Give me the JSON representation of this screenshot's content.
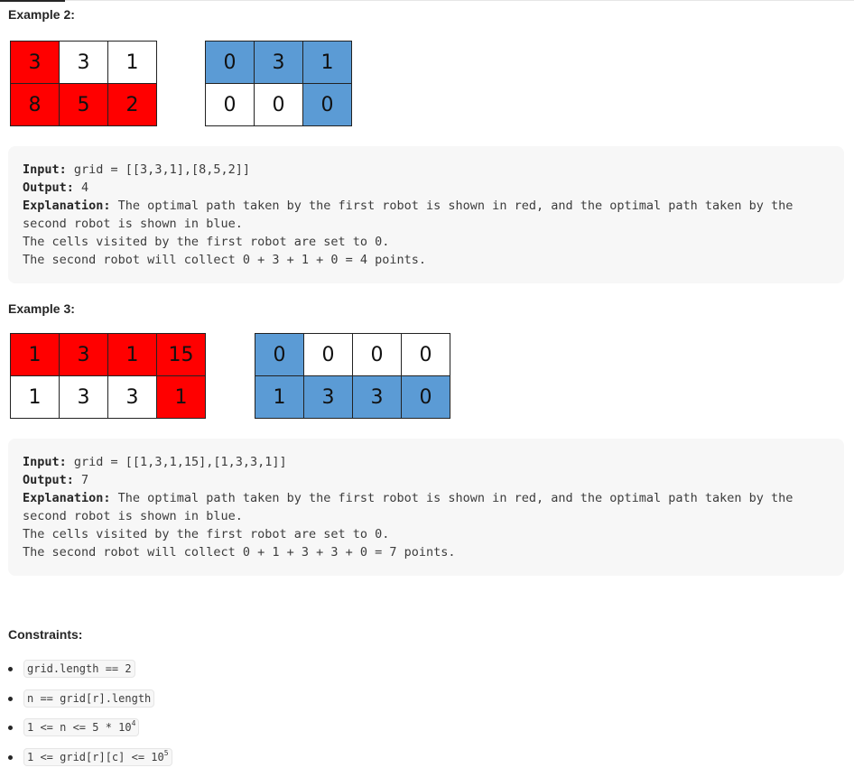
{
  "example2": {
    "heading": "Example 2:",
    "grid_red": [
      [
        {
          "v": "3",
          "c": "red"
        },
        {
          "v": "3",
          "c": "white"
        },
        {
          "v": "1",
          "c": "white"
        }
      ],
      [
        {
          "v": "8",
          "c": "red"
        },
        {
          "v": "5",
          "c": "red"
        },
        {
          "v": "2",
          "c": "red"
        }
      ]
    ],
    "grid_blue": [
      [
        {
          "v": "0",
          "c": "blue"
        },
        {
          "v": "3",
          "c": "blue"
        },
        {
          "v": "1",
          "c": "blue"
        }
      ],
      [
        {
          "v": "0",
          "c": "white"
        },
        {
          "v": "0",
          "c": "white"
        },
        {
          "v": "0",
          "c": "blue"
        }
      ]
    ],
    "input_label": "Input:",
    "input_value": " grid = [[3,3,1],[8,5,2]]",
    "output_label": "Output:",
    "output_value": " 4",
    "explanation_label": "Explanation:",
    "explanation_line1": " The optimal path taken by the first robot is shown in red, and the optimal path taken by the",
    "explanation_line2": "second robot is shown in blue.",
    "explanation_line3": "The cells visited by the first robot are set to 0.",
    "explanation_line4": "The second robot will collect 0 + 3 + 1 + 0 = 4 points."
  },
  "example3": {
    "heading": "Example 3:",
    "grid_red": [
      [
        {
          "v": "1",
          "c": "red"
        },
        {
          "v": "3",
          "c": "red"
        },
        {
          "v": "1",
          "c": "red"
        },
        {
          "v": "15",
          "c": "red"
        }
      ],
      [
        {
          "v": "1",
          "c": "white"
        },
        {
          "v": "3",
          "c": "white"
        },
        {
          "v": "3",
          "c": "white"
        },
        {
          "v": "1",
          "c": "red"
        }
      ]
    ],
    "grid_blue": [
      [
        {
          "v": "0",
          "c": "blue"
        },
        {
          "v": "0",
          "c": "white"
        },
        {
          "v": "0",
          "c": "white"
        },
        {
          "v": "0",
          "c": "white"
        }
      ],
      [
        {
          "v": "1",
          "c": "blue"
        },
        {
          "v": "3",
          "c": "blue"
        },
        {
          "v": "3",
          "c": "blue"
        },
        {
          "v": "0",
          "c": "blue"
        }
      ]
    ],
    "input_label": "Input:",
    "input_value": " grid = [[1,3,1,15],[1,3,3,1]]",
    "output_label": "Output:",
    "output_value": " 7",
    "explanation_label": "Explanation:",
    "explanation_line1": " The optimal path taken by the first robot is shown in red, and the optimal path taken by the",
    "explanation_line2": "second robot is shown in blue.",
    "explanation_line3": "The cells visited by the first robot are set to 0.",
    "explanation_line4": "The second robot will collect 0 + 1 + 3 + 3 + 0 = 7 points."
  },
  "constraints": {
    "heading": "Constraints:",
    "item1": "grid.length == 2",
    "item2": "n == grid[r].length",
    "item3_base": "1 <= n <= 5 * 10",
    "item3_sup": "4",
    "item4_base": "1 <= grid[r][c] <= 10",
    "item4_sup": "5"
  },
  "colors": {
    "red": "#ff0000",
    "blue": "#5b9bd5",
    "code_bg": "#f7f7f7"
  }
}
